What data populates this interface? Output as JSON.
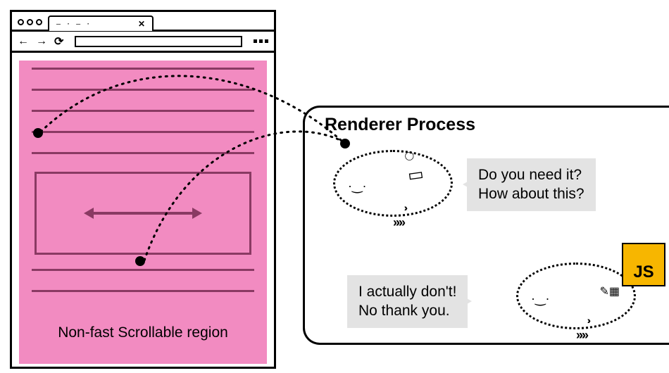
{
  "browser": {
    "tab_placeholder_glyphs": "— · — ·",
    "tab_close_glyph": "✕",
    "nav_back_glyph": "←",
    "nav_fwd_glyph": "→",
    "reload_glyph": "⟳",
    "nonfast_label": "Non-fast Scrollable region"
  },
  "panel": {
    "title": "Renderer Process",
    "threads": {
      "compositor": {
        "speech_line1": "Do you need it?",
        "speech_line2": "How about this?",
        "desk_glyph": "🗄️",
        "face_glyph": "·‿·",
        "chevrons": "›››",
        "chevrons2": "»»»"
      },
      "main": {
        "speech_line1": "I actually don't!",
        "speech_line2": "No thank you.",
        "js_label": "JS",
        "tools_glyph": "✎▦",
        "face_glyph": "·‿·",
        "chevrons": "›››",
        "chevrons2": "»»»"
      }
    }
  }
}
